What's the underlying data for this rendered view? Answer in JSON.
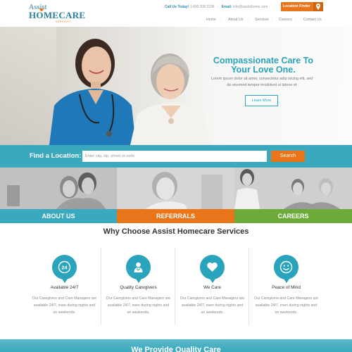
{
  "logo": {
    "line1": "Assist",
    "line2": "HOMECARE",
    "line3": "SERVICES"
  },
  "contact": {
    "call_label": "Call Us Today!",
    "phone": "1.800.208.2298",
    "email_label": "Email:",
    "email": "info@assisthome.com"
  },
  "location_finder": {
    "label": "Location Finder",
    "icon": "map-pin-icon"
  },
  "nav": [
    "Home",
    "About Us",
    "Services",
    "Careers",
    "Contact Us"
  ],
  "hero": {
    "title": "Compassionate Care To Your Love One.",
    "body": "Lorem ipsum dolor sit amet, consectetur adip isicing elit, sed do eiusmod tempor incididunt ut labore et",
    "button": "Learn More"
  },
  "find": {
    "label": "Find a Location:",
    "placeholder": "Enter city, zip, street or code",
    "button": "Search"
  },
  "panels": [
    {
      "label": "ABOUT US",
      "color": "#3aa8bd"
    },
    {
      "label": "REFERRALS",
      "color": "#e8751a"
    },
    {
      "label": "CAREERS",
      "color": "#6cab3a"
    }
  ],
  "why": {
    "title": "Why Choose Assist Homecare Services",
    "features": [
      {
        "title": "Available 24/7",
        "icon": "24-hour-icon",
        "text": "Our Caregivers and Care Managers are available 24/7, even during nights and on weekends."
      },
      {
        "title": "Quality Caregivers",
        "icon": "caregiver-icon",
        "text": "Our Caregivers and Care Managers are available 24/7, even during nights and on weekends."
      },
      {
        "title": "We Care",
        "icon": "heart-icon",
        "text": "Our Caregivers and Care Managers are available 24/7, even during nights and on weekends."
      },
      {
        "title": "Peace of Mind",
        "icon": "smiley-icon",
        "text": "Our Caregivers and Care Managers are available 24/7, even during nights and on weekends."
      }
    ]
  },
  "provide": {
    "title": "We Provide Quality Care"
  },
  "colors": {
    "teal": "#2aa3bd",
    "orange": "#e8751a",
    "green": "#6cab3a"
  }
}
